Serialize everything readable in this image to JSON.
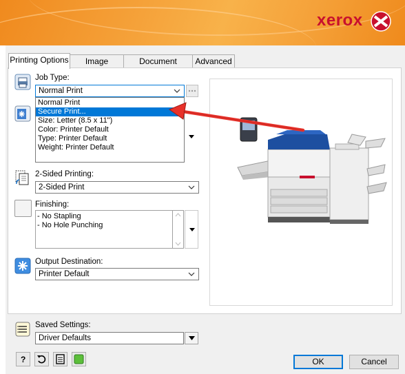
{
  "brand": {
    "name": "xerox"
  },
  "tabs": [
    {
      "label": "Printing Options",
      "active": true
    },
    {
      "label": "Image Options",
      "active": false
    },
    {
      "label": "Document Options",
      "active": false
    },
    {
      "label": "Advanced",
      "active": false
    }
  ],
  "job_type": {
    "label": "Job Type:",
    "value": "Normal Print",
    "options": [
      "Normal Print",
      "Secure Print...",
      "Size: Letter (8.5 x 11\")",
      "Color: Printer Default",
      "Type: Printer Default",
      "Weight: Printer Default"
    ],
    "highlighted_option": "Secure Print..."
  },
  "two_sided": {
    "label": "2-Sided Printing:",
    "value": "2-Sided Print"
  },
  "finishing": {
    "label": "Finishing:",
    "items": [
      "- No Stapling",
      "- No Hole Punching"
    ]
  },
  "output": {
    "label": "Output Destination:",
    "value": "Printer Default"
  },
  "saved_settings": {
    "label": "Saved Settings:",
    "value": "Driver Defaults"
  },
  "buttons": {
    "ok": "OK",
    "cancel": "Cancel"
  },
  "colors": {
    "accent": "#0078d7",
    "brand": "#c8102e",
    "arrow": "#e8312a",
    "header": "#f5a23a"
  }
}
